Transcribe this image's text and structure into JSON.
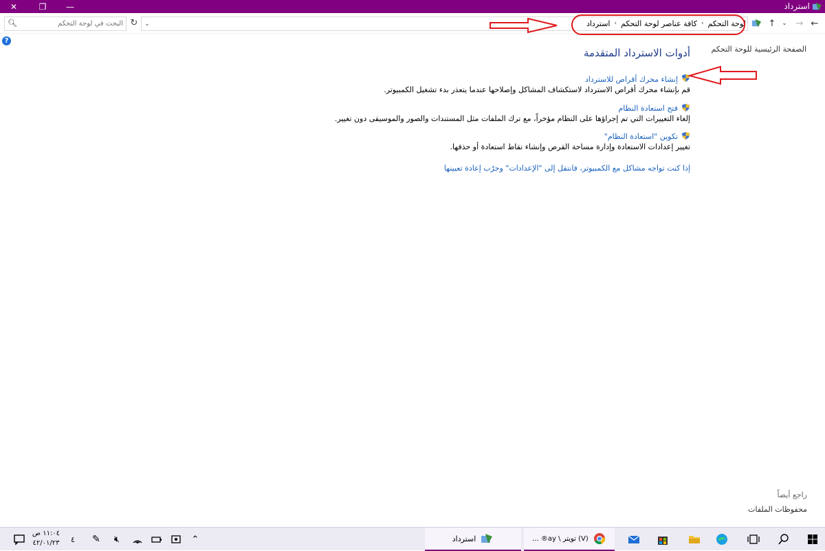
{
  "window": {
    "title": "استرداد"
  },
  "address": {
    "crumbs": [
      "لوحة التحكم",
      "كافة عناصر لوحة التحكم",
      "استرداد"
    ],
    "search_placeholder": "البحث في لوحة التحكم"
  },
  "side": {
    "home": "الصفحة الرئيسية للوحة التحكم"
  },
  "main": {
    "heading": "أدوات الاسترداد المتقدمة",
    "tasks": [
      {
        "link": "إنشاء محرك أقراص للاسترداد",
        "desc": "قم بإنشاء محرك أقراص الاسترداد لاستكشاف المشاكل وإصلاحها عندما يتعذر بدء تشغيل الكمبيوتر."
      },
      {
        "link": "فتح استعادة النظام",
        "desc": "إلغاء التغييرات التي تم إجراؤها على النظام مؤخراً، مع ترك الملفات مثل المستندات والصور والموسيقى دون تغيير."
      },
      {
        "link": "تكوين \"استعادة النظام\"",
        "desc": "تغيير إعدادات الاستعادة وإدارة مساحة القرص وإنشاء نقاط استعادة أو حذفها."
      }
    ],
    "trouble_link": "إذا كنت تواجه مشاكل مع الكمبيوتر، فانتقل إلى \"الإعدادات\" وجرّب إعادة تعيينها"
  },
  "see_also": {
    "label": "راجع أيضاً",
    "file_history": "محفوظات الملفات"
  },
  "taskbar": {
    "active_window": "استرداد",
    "browser_tab": "(V) تويتر \\ ay® ...",
    "time": "١١:٠٤ ص",
    "date": "٤٢/٠١/٢٣",
    "notif_count": "٤"
  },
  "colors": {
    "titlebar": "#800080",
    "link": "#1a62c0",
    "heading": "#1e3a8a",
    "annotation": "#e0191c"
  }
}
